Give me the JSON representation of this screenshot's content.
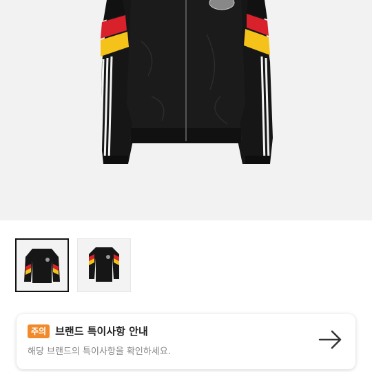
{
  "product": {
    "hero_image": "black-track-jacket-with-red-yellow-stripes",
    "thumbnails": [
      {
        "name": "jacket-front-thumbnail",
        "selected": true
      },
      {
        "name": "jacket-front-thumbnail-alt",
        "selected": false
      }
    ]
  },
  "notice": {
    "badge": "주의",
    "title": "브랜드 특이사항 안내",
    "description": "해당 브랜드의 특이사항을 확인하세요.",
    "arrow_icon": "arrow-right-icon"
  },
  "colors": {
    "badge": "#f08a2b",
    "jacket": "#161616",
    "red": "#d8212b",
    "yellow": "#f5c21a"
  }
}
